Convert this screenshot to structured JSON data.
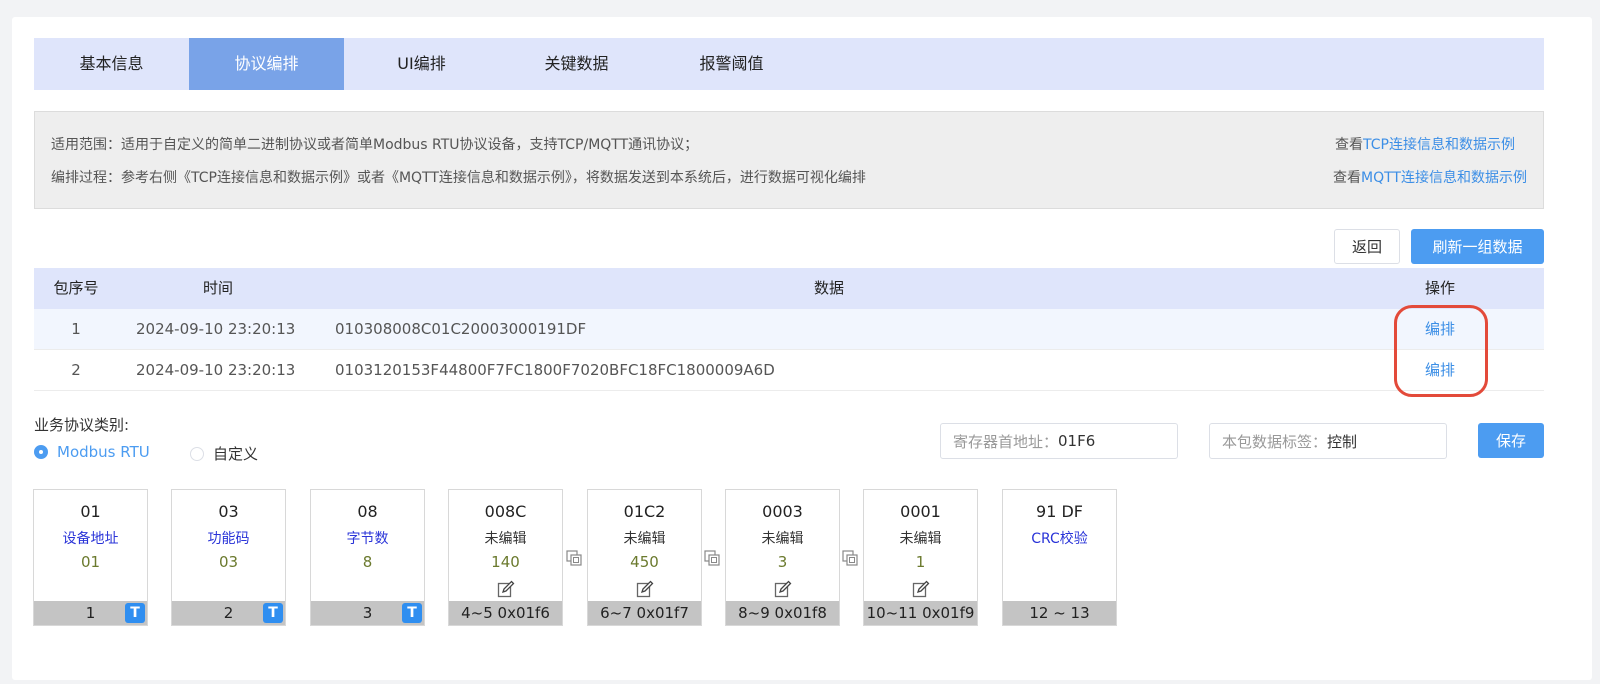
{
  "tabs": [
    {
      "label": "基本信息",
      "active": false
    },
    {
      "label": "协议编排",
      "active": true
    },
    {
      "label": "UI编排",
      "active": false
    },
    {
      "label": "关键数据",
      "active": false
    },
    {
      "label": "报警阈值",
      "active": false
    }
  ],
  "notice": {
    "line1": "适用范围：适用于自定义的简单二进制协议或者简单Modbus RTU协议设备，支持TCP/MQTT通讯协议；",
    "line2": "编排过程：参考右侧《TCP连接信息和数据示例》或者《MQTT连接信息和数据示例》，将数据发送到本系统后，进行数据可视化编排",
    "link1_prefix": "查看",
    "link1_text": "TCP连接信息和数据示例",
    "link2_prefix": "查看",
    "link2_text": "MQTT连接信息和数据示例"
  },
  "actions": {
    "back": "返回",
    "refresh": "刷新一组数据"
  },
  "table": {
    "headers": {
      "seq": "包序号",
      "time": "时间",
      "data": "数据",
      "op": "操作"
    },
    "rows": [
      {
        "seq": "1",
        "time": "2024-09-10 23:20:13",
        "data": "010308008C01C20003000191DF",
        "op": "编排"
      },
      {
        "seq": "2",
        "time": "2024-09-10 23:20:13",
        "data": "0103120153F44800F7FC1800F7020BFC18FC1800009A6D",
        "op": "编排"
      }
    ]
  },
  "protocol": {
    "label": "业务协议类别:",
    "options": [
      {
        "label": "Modbus RTU",
        "selected": true
      },
      {
        "label": "自定义",
        "selected": false
      }
    ],
    "register_label": "寄存器首地址：",
    "register_value": "01F6",
    "tag_label": "本包数据标签：",
    "tag_value": "控制",
    "save": "保存"
  },
  "blocks": [
    {
      "hex": "01",
      "name": "设备地址",
      "value": "01",
      "foot": "1",
      "badge": "T"
    },
    {
      "hex": "03",
      "name": "功能码",
      "value": "03",
      "foot": "2",
      "badge": "T"
    },
    {
      "hex": "08",
      "name": "字节数",
      "value": "8",
      "foot": "3",
      "badge": "T"
    },
    {
      "hex": "008C",
      "name": "未编辑",
      "value": "140",
      "foot": "4~5 0x01f6"
    },
    {
      "hex": "01C2",
      "name": "未编辑",
      "value": "450",
      "foot": "6~7 0x01f7"
    },
    {
      "hex": "0003",
      "name": "未编辑",
      "value": "3",
      "foot": "8~9 0x01f8"
    },
    {
      "hex": "0001",
      "name": "未编辑",
      "value": "1",
      "foot": "10~11 0x01f9"
    },
    {
      "hex": "91 DF",
      "name": "CRC校验",
      "value": "",
      "foot": "12 ~ 13"
    }
  ],
  "colors": {
    "accent": "#4c9cf1",
    "tab_bg": "#dfe5fb",
    "tab_active": "#79a3e8",
    "highlight": "#e34a3a"
  }
}
